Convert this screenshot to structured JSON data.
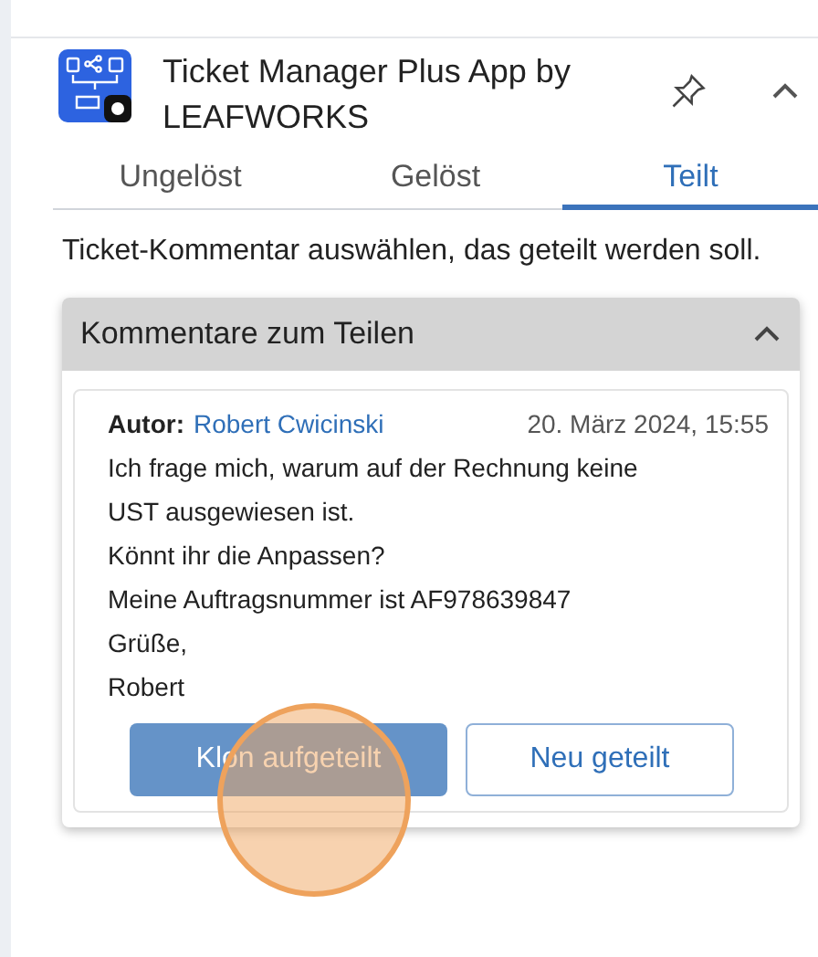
{
  "app": {
    "title": "Ticket Manager Plus App by LEAFWORKS"
  },
  "tabs": [
    {
      "label": "Ungelöst",
      "selected": false
    },
    {
      "label": "Gelöst",
      "selected": false
    },
    {
      "label": "Teilt",
      "selected": true
    }
  ],
  "instruction": "Ticket-Kommentar auswählen, das geteilt werden soll.",
  "accordion": {
    "title": "Kommentare zum Teilen",
    "expanded": true,
    "comment": {
      "author_label": "Autor:",
      "author": "Robert Cwicinski",
      "date": "20. März 2024, 15:55",
      "lines": [
        "Ich frage mich, warum auf der Rechnung keine UST ausgewiesen ist.",
        "Könnt ihr die Anpassen?",
        "Meine Auftragsnummer ist AF978639847",
        "Grüße,",
        "Robert"
      ]
    },
    "buttons": [
      {
        "label": "Klon aufgeteilt",
        "kind": "primary"
      },
      {
        "label": "Neu geteilt",
        "kind": "secondary"
      }
    ]
  },
  "click_highlight": true
}
